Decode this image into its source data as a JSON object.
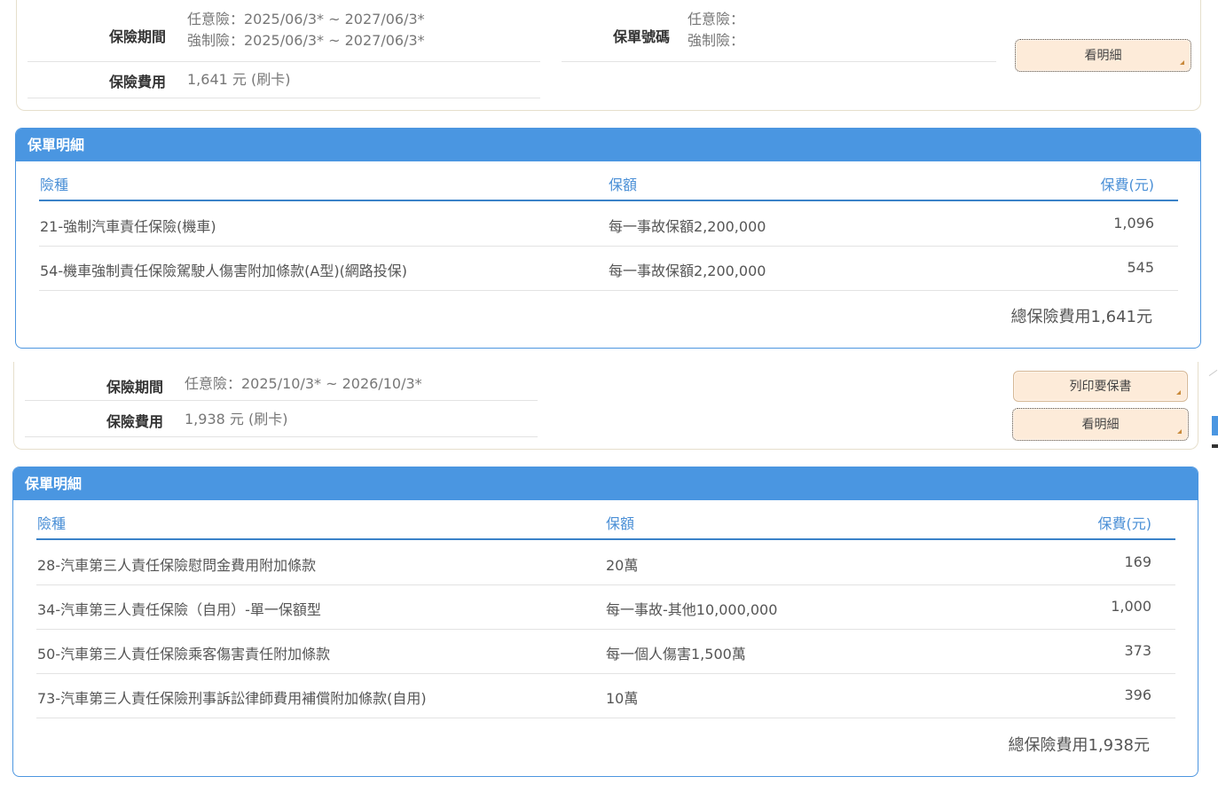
{
  "policy1": {
    "period_label": "保險期間",
    "period_voluntary": "任意險：2025/06/3* ~ 2027/06/3*",
    "period_compulsory": "強制險：2025/06/3* ~ 2027/06/3*",
    "fee_label": "保險費用",
    "fee_value": "1,641 元 (刷卡)",
    "policy_no_label": "保單號碼",
    "policy_no_voluntary": "任意險：",
    "policy_no_compulsory": "強制險：",
    "detail_button": "看明細"
  },
  "detail1": {
    "title": "保單明細",
    "headers": {
      "type": "險種",
      "amount": "保額",
      "premium": "保費(元)"
    },
    "rows": [
      {
        "type": "21-強制汽車責任保險(機車)",
        "amount": "每一事故保額2,200,000",
        "premium": "1,096"
      },
      {
        "type": "54-機車強制責任保險駕駛人傷害附加條款(A型)(網路投保)",
        "amount": "每一事故保額2,200,000",
        "premium": "545"
      }
    ],
    "total": "總保險費用1,641元"
  },
  "policy2": {
    "period_label": "保險期間",
    "period_voluntary": "任意險：2025/10/3* ~ 2026/10/3*",
    "fee_label": "保險費用",
    "fee_value": "1,938 元 (刷卡)",
    "print_button": "列印要保書",
    "detail_button": "看明細"
  },
  "detail2": {
    "title": "保單明細",
    "headers": {
      "type": "險種",
      "amount": "保額",
      "premium": "保費(元)"
    },
    "rows": [
      {
        "type": "28-汽車第三人責任保險慰問金費用附加條款",
        "amount": "20萬",
        "premium": "169"
      },
      {
        "type": "34-汽車第三人責任保險（自用）-單一保額型",
        "amount": "每一事故-其他10,000,000",
        "premium": "1,000"
      },
      {
        "type": "50-汽車第三人責任保險乘客傷害責任附加條款",
        "amount": "每一個人傷害1,500萬",
        "premium": "373"
      },
      {
        "type": "73-汽車第三人責任保險刑事訴訟律師費用補償附加條款(自用)",
        "amount": "10萬",
        "premium": "396"
      }
    ],
    "total": "總保險費用1,938元"
  }
}
